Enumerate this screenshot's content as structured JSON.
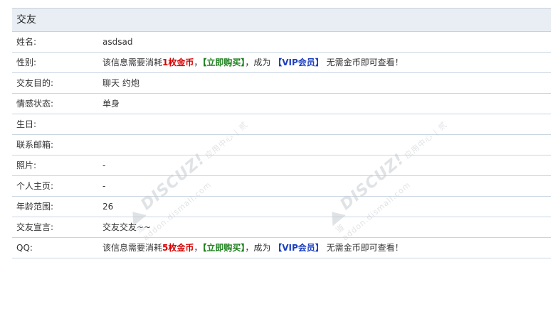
{
  "section_title": "交友",
  "rows": [
    {
      "label": "姓名:",
      "value": "asdsad"
    },
    {
      "label": "性别:"
    },
    {
      "label": "交友目的:",
      "value": "聊天 约炮"
    },
    {
      "label": "情感状态:",
      "value": "单身"
    },
    {
      "label": "生日:",
      "value": ""
    },
    {
      "label": "联系邮箱:",
      "value": ""
    },
    {
      "label": "照片:",
      "value": "-"
    },
    {
      "label": "个人主页:",
      "value": "-"
    },
    {
      "label": "年龄范围:",
      "value": "26"
    },
    {
      "label": "交友宣言:",
      "value": "交友交友~~"
    },
    {
      "label": "QQ:"
    }
  ],
  "paywall_gender": {
    "prefix": "该信息需要消耗",
    "coins": "1枚金币",
    "sep1": "，",
    "buy": "【立即购买】",
    "mid": "，成为",
    "vip": "【VIP会员】",
    "suffix": "无需金币即可查看！"
  },
  "paywall_qq": {
    "prefix": "该信息需要消耗",
    "coins": "5枚金币",
    "sep1": "，",
    "buy": "【立即购买】",
    "mid": "，成为",
    "vip": "【VIP会员】",
    "suffix": "无需金币即可查看！"
  },
  "watermark": {
    "brand": "DISCUZ!",
    "cn": "应用中心 | 贰道",
    "url": "addon.dismall.com"
  }
}
